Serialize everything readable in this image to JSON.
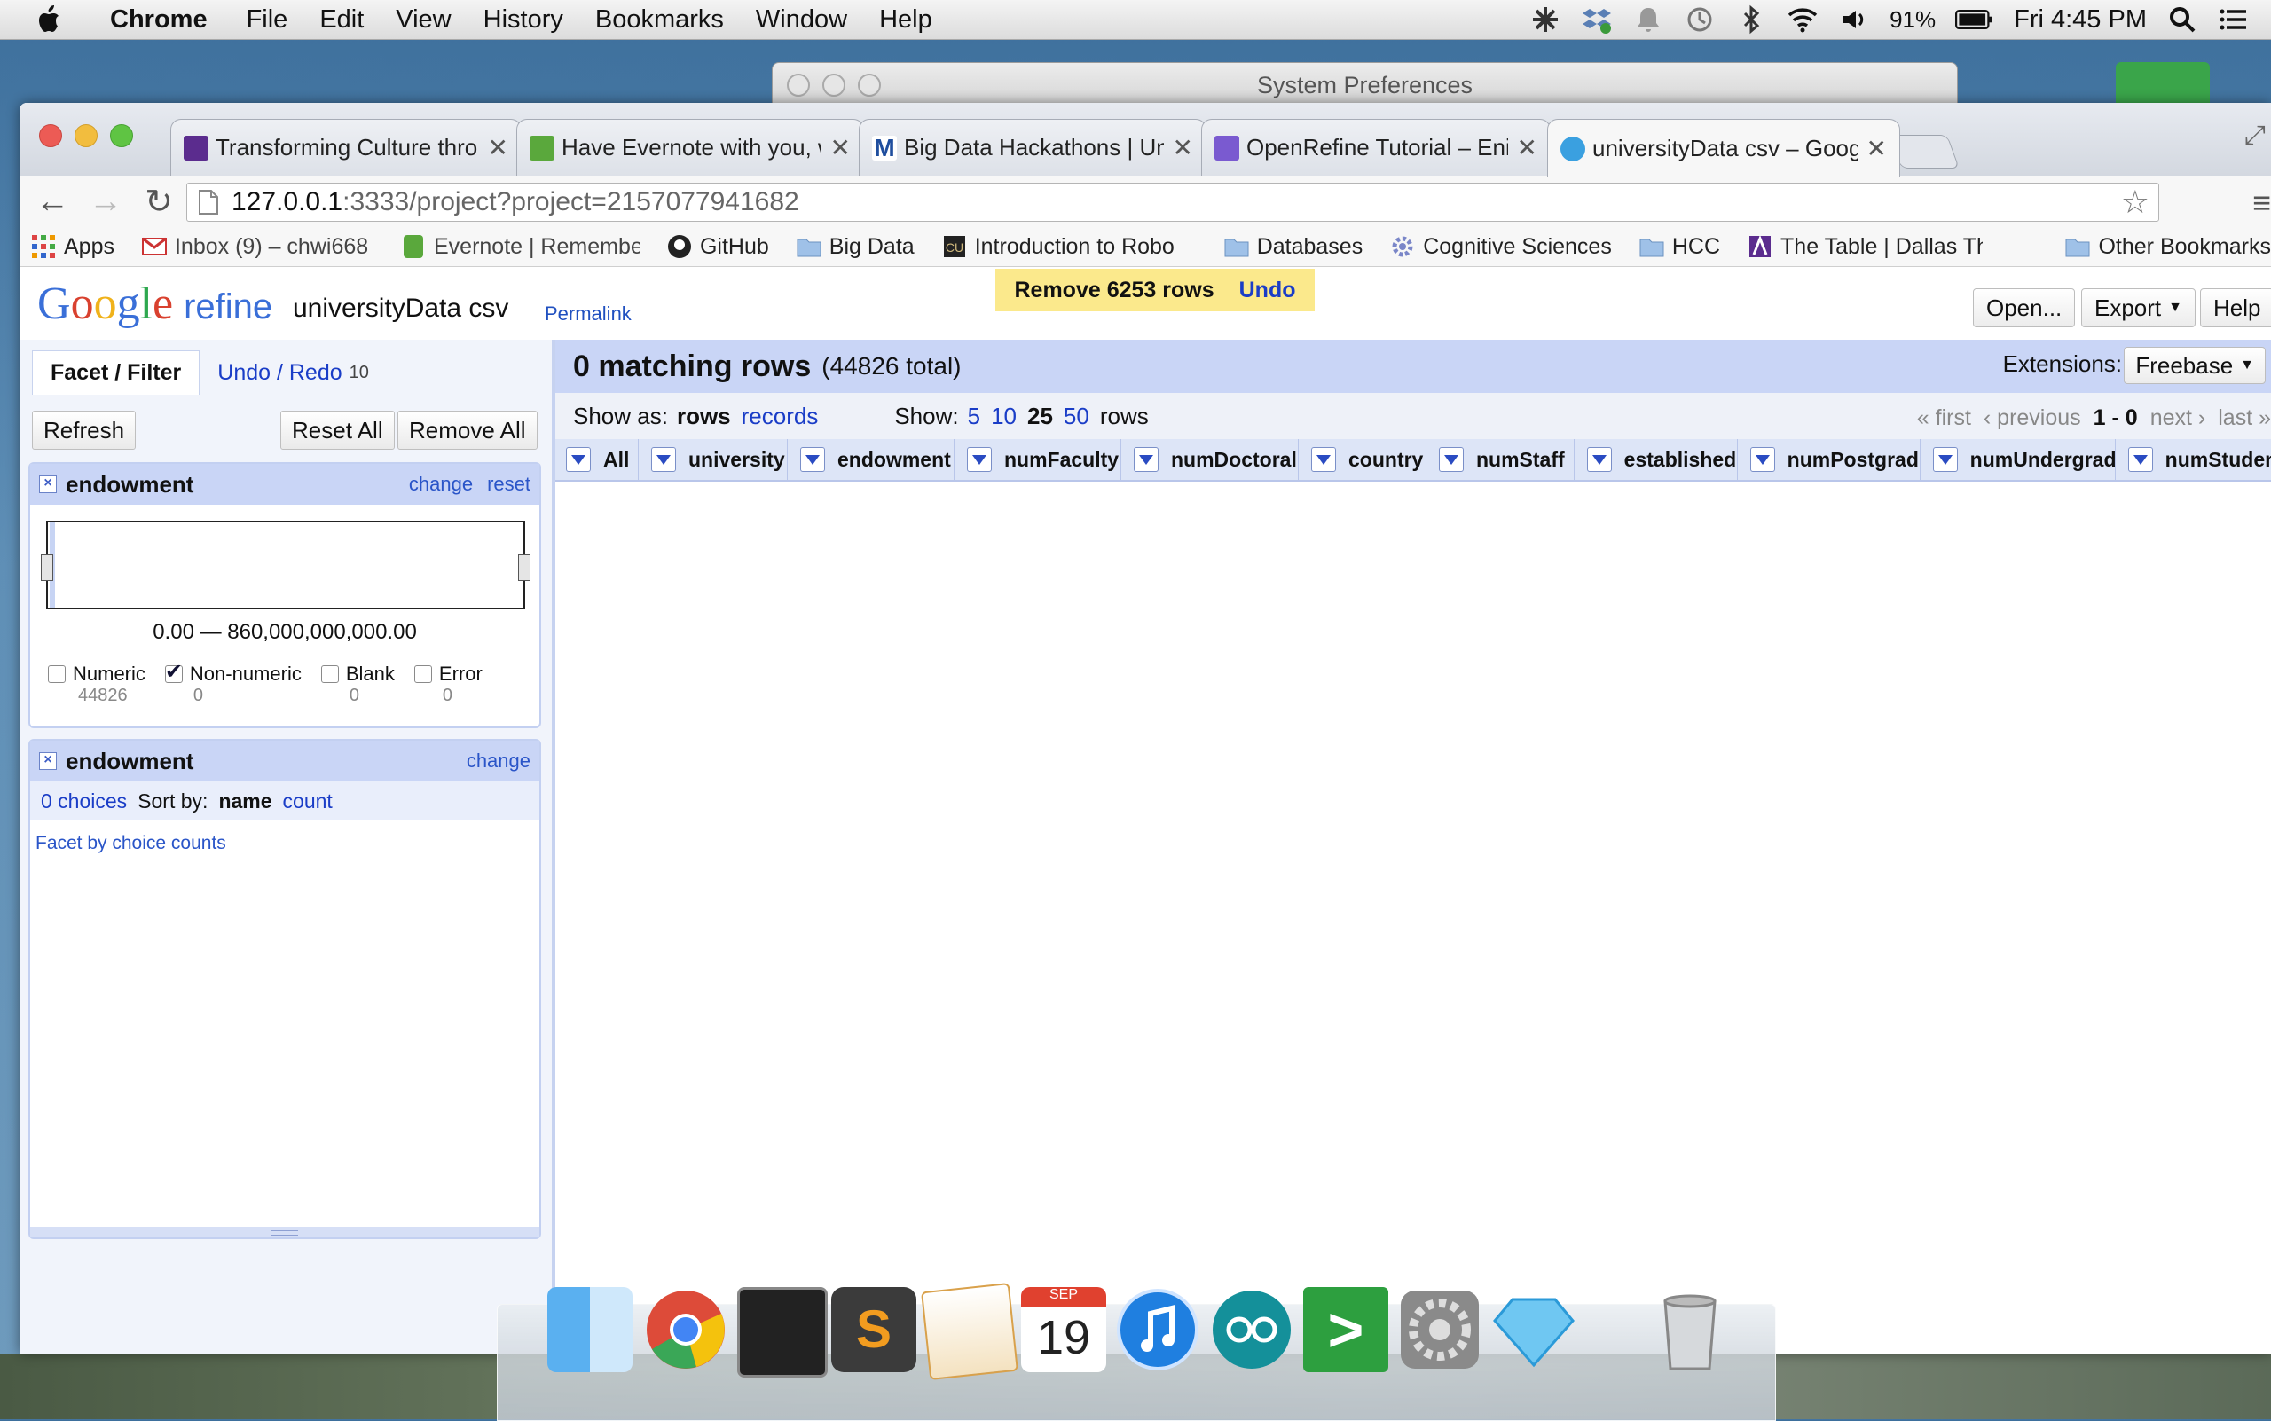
{
  "menubar": {
    "app": "Chrome",
    "items": [
      "File",
      "Edit",
      "View",
      "History",
      "Bookmarks",
      "Window",
      "Help"
    ],
    "battery": "91%",
    "clock": "Fri 4:45 PM"
  },
  "background_window": {
    "title": "System Preferences"
  },
  "browser": {
    "tabs": [
      {
        "label": "Transforming Culture thro",
        "favicon_color": "#5b2c8e"
      },
      {
        "label": "Have Evernote with you, w",
        "favicon_color": "#5aa83c"
      },
      {
        "label": "Big Data Hackathons | Univ",
        "favicon_color": "#1f4e9e"
      },
      {
        "label": "OpenRefine Tutorial – Enip",
        "favicon_color": "#7a5ad0"
      },
      {
        "label": "universityData csv – Googl",
        "favicon_color": "#3aa0e0"
      }
    ],
    "url_host": "127.0.0.1",
    "url_path": ":3333/project?project=2157077941682",
    "bookmarks": [
      {
        "label": "Apps",
        "icon": "apps-grid-icon"
      },
      {
        "label": "Inbox (9) – chwi668",
        "icon": "gmail-icon"
      },
      {
        "label": "Evernote | Remembe",
        "icon": "evernote-icon"
      },
      {
        "label": "GitHub",
        "icon": "github-icon"
      },
      {
        "label": "Big Data",
        "icon": "folder-icon"
      },
      {
        "label": "Introduction to Robo",
        "icon": "cu-icon"
      },
      {
        "label": "Databases",
        "icon": "folder-icon"
      },
      {
        "label": "Cognitive Sciences",
        "icon": "gear-icon"
      },
      {
        "label": "HCC",
        "icon": "folder-icon"
      },
      {
        "label": "The Table | Dallas Th",
        "icon": "dallas-icon"
      },
      {
        "label": "Other Bookmarks",
        "icon": "folder-icon"
      }
    ]
  },
  "refine": {
    "logo_google": "Google",
    "logo_refine": "refine",
    "project_name": "universityData csv",
    "permalink": "Permalink",
    "notification": {
      "message": "Remove 6253 rows",
      "undo": "Undo"
    },
    "header_buttons": {
      "open": "Open...",
      "export": "Export",
      "help": "Help"
    },
    "left": {
      "tab_facet": "Facet / Filter",
      "tab_undo": "Undo / Redo",
      "undo_count": "10",
      "refresh": "Refresh",
      "reset_all": "Reset All",
      "remove_all": "Remove All",
      "facet1": {
        "title": "endowment",
        "change": "change",
        "reset": "reset",
        "range": "0.00 — 860,000,000,000.00",
        "checks": [
          {
            "label": "Numeric",
            "count": "44826",
            "checked": false
          },
          {
            "label": "Non-numeric",
            "count": "0",
            "checked": true
          },
          {
            "label": "Blank",
            "count": "0",
            "checked": false
          },
          {
            "label": "Error",
            "count": "0",
            "checked": false
          }
        ]
      },
      "facet2": {
        "title": "endowment",
        "change": "change",
        "choices": "0 choices",
        "sort_by": "Sort by:",
        "sort_name": "name",
        "sort_count": "count",
        "facet_by_counts": "Facet by choice counts"
      }
    },
    "right": {
      "matching": "0 matching rows",
      "total": "(44826 total)",
      "extensions_label": "Extensions:",
      "extensions_button": "Freebase",
      "show_as": "Show as:",
      "show_rows": "rows",
      "show_records": "records",
      "show_label": "Show:",
      "page_sizes": [
        "5",
        "10",
        "25",
        "50"
      ],
      "page_size_selected": "25",
      "rows_word": "rows",
      "pager": {
        "first": "« first",
        "previous": "‹ previous",
        "range": "1 - 0",
        "next": "next ›",
        "last": "last »"
      },
      "columns": [
        "All",
        "university",
        "endowment",
        "numFaculty",
        "numDoctoral",
        "country",
        "numStaff",
        "established",
        "numPostgrad",
        "numUndergrad",
        "numStuden"
      ]
    }
  },
  "dock": {
    "apps": [
      "finder-icon",
      "chrome-icon",
      "terminal-icon",
      "sublime-icon",
      "pages-icon",
      "calendar-icon",
      "itunes-icon",
      "arduino-icon",
      "codekit-icon",
      "system-preferences-icon",
      "sketch-icon",
      "trash-icon"
    ],
    "calendar_month": "SEP",
    "calendar_day": "19"
  }
}
